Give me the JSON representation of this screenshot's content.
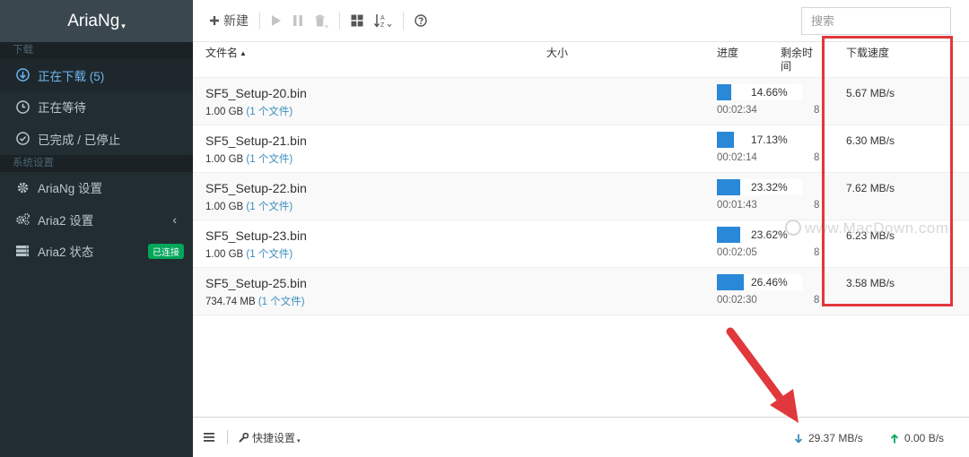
{
  "app": {
    "title": "AriaNg",
    "title_caret": "▾"
  },
  "sidebar": {
    "section_download": "下载",
    "items": [
      {
        "label": "正在下载 (5)",
        "icon": "download-circle-icon",
        "active": true
      },
      {
        "label": "正在等待",
        "icon": "clock-icon"
      },
      {
        "label": "已完成 / 已停止",
        "icon": "check-circle-icon"
      }
    ],
    "section_settings": "系统设置",
    "settings": [
      {
        "label": "AriaNg 设置",
        "icon": "gear-icon"
      },
      {
        "label": "Aria2 设置",
        "icon": "gears-icon",
        "chevron": "‹"
      },
      {
        "label": "Aria2 状态",
        "icon": "server-icon",
        "badge": "已连接"
      }
    ]
  },
  "toolbar": {
    "new_label": "新建",
    "search_placeholder": "搜索"
  },
  "table": {
    "headers": {
      "filename": "文件名",
      "size": "大小",
      "progress": "进度",
      "remaining": "剩余时间",
      "speed": "下载速度"
    },
    "rows": [
      {
        "name": "SF5_Setup-20.bin",
        "size": "1.00 GB",
        "files": "(1 个文件)",
        "progress_text": "14.66%",
        "progress": 0.1466,
        "remaining": "00:02:34",
        "clipped": "8",
        "speed": "5.67 MB/s"
      },
      {
        "name": "SF5_Setup-21.bin",
        "size": "1.00 GB",
        "files": "(1 个文件)",
        "progress_text": "17.13%",
        "progress": 0.1713,
        "remaining": "00:02:14",
        "clipped": "8",
        "speed": "6.30 MB/s"
      },
      {
        "name": "SF5_Setup-22.bin",
        "size": "1.00 GB",
        "files": "(1 个文件)",
        "progress_text": "23.32%",
        "progress": 0.2332,
        "remaining": "00:01:43",
        "clipped": "8",
        "speed": "7.62 MB/s"
      },
      {
        "name": "SF5_Setup-23.bin",
        "size": "1.00 GB",
        "files": "(1 个文件)",
        "progress_text": "23.62%",
        "progress": 0.2362,
        "remaining": "00:02:05",
        "clipped": "8",
        "speed": "6.23 MB/s"
      },
      {
        "name": "SF5_Setup-25.bin",
        "size": "734.74 MB",
        "files": "(1 个文件)",
        "progress_text": "26.46%",
        "progress": 0.2646,
        "remaining": "00:02:30",
        "clipped": "8",
        "speed": "3.58 MB/s"
      }
    ]
  },
  "footer": {
    "quick_settings": "快捷设置",
    "download_speed": "29.37 MB/s",
    "upload_speed": "0.00 B/s"
  },
  "watermark": "www.MacDown.com",
  "colors": {
    "sidebar_bg": "#222d32",
    "accent_blue": "#2a88d8",
    "highlight_red": "#e0383c",
    "connected_green": "#00a65a"
  }
}
